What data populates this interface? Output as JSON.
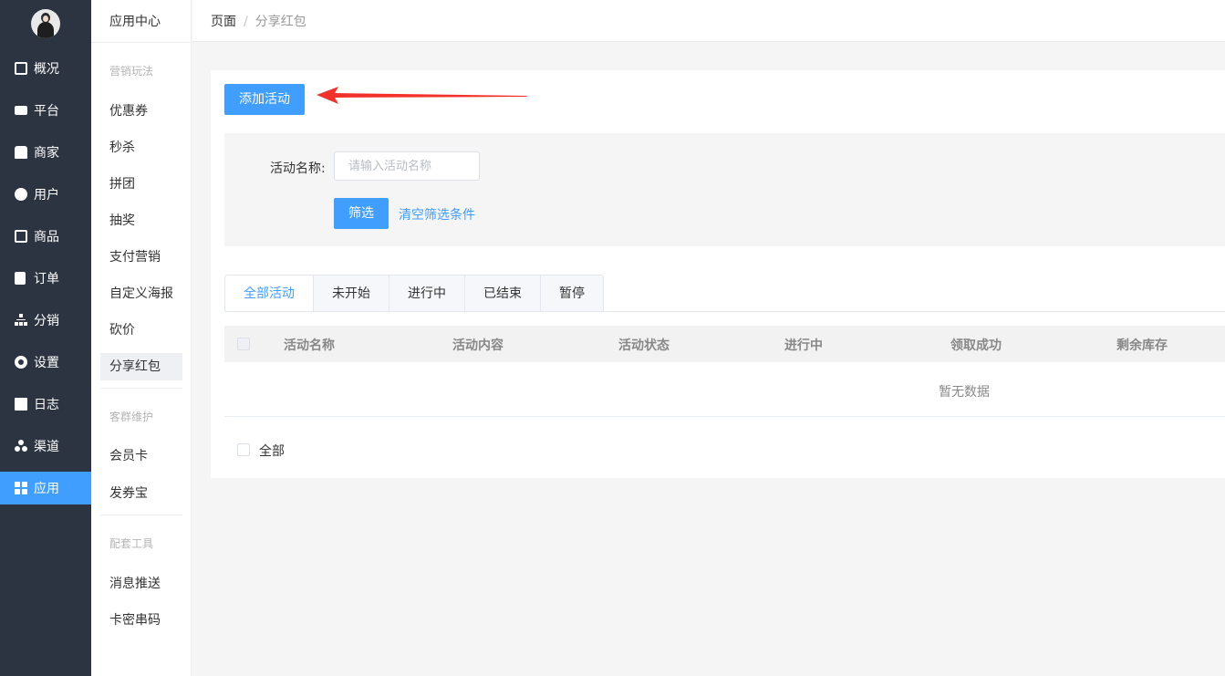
{
  "nav": {
    "items": [
      {
        "label": "概况",
        "icon": "chart-icon"
      },
      {
        "label": "平台",
        "icon": "monitor-icon"
      },
      {
        "label": "商家",
        "icon": "store-icon"
      },
      {
        "label": "用户",
        "icon": "user-icon"
      },
      {
        "label": "商品",
        "icon": "bag-icon"
      },
      {
        "label": "订单",
        "icon": "clipboard-icon"
      },
      {
        "label": "分销",
        "icon": "hierarchy-icon"
      },
      {
        "label": "设置",
        "icon": "gear-icon"
      },
      {
        "label": "日志",
        "icon": "book-icon"
      },
      {
        "label": "渠道",
        "icon": "channels-icon"
      },
      {
        "label": "应用",
        "icon": "grid-icon"
      }
    ],
    "active_color": "#409eff"
  },
  "subnav": {
    "title": "应用中心",
    "groups": [
      "营销玩法",
      "客群维护",
      "配套工具"
    ],
    "items": [
      "优惠券",
      "秒杀",
      "拼团",
      "抽奖",
      "支付营销",
      "自定义海报",
      "砍价",
      "分享红包",
      "会员卡",
      "发券宝",
      "消息推送",
      "卡密串码"
    ]
  },
  "breadcrumb": {
    "root": "页面",
    "separator": "/",
    "current": "分享红包"
  },
  "main": {
    "add_button": "添加活动",
    "filter": {
      "name_label": "活动名称:",
      "name_placeholder": "请输入活动名称",
      "search_button": "筛选",
      "clear_link": "清空筛选条件"
    },
    "tabs": [
      "全部活动",
      "未开始",
      "进行中",
      "已结束",
      "暂停"
    ],
    "table": {
      "columns": [
        "活动名称",
        "活动内容",
        "活动状态",
        "进行中",
        "领取成功",
        "剩余库存"
      ],
      "empty_text": "暂无数据"
    },
    "footer_select_all": "全部"
  }
}
